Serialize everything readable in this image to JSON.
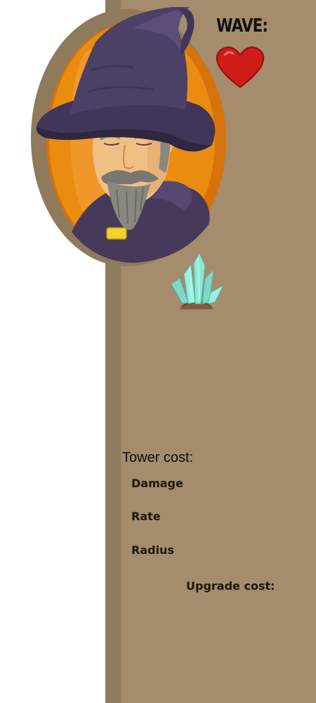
{
  "hud": {
    "wave_label": "WAVE:",
    "life_icon": "heart-icon",
    "gem_icon": "crystal-icon"
  },
  "tower_info": {
    "tower_cost_label": "Tower cost:",
    "stats": {
      "damage_label": "Damage",
      "rate_label": "Rate",
      "radius_label": "Radius"
    },
    "upgrade_cost_label": "Upgrade cost:"
  },
  "colors": {
    "panel": "#a48c6c",
    "panel_edge": "#8e7a5e",
    "portrait_frame": "#907a5c",
    "portrait_bg": "#e98a0c",
    "wizard_robe": "#4a3e5c",
    "heart": "#d01b1b",
    "crystal": "#8ee8d6"
  }
}
